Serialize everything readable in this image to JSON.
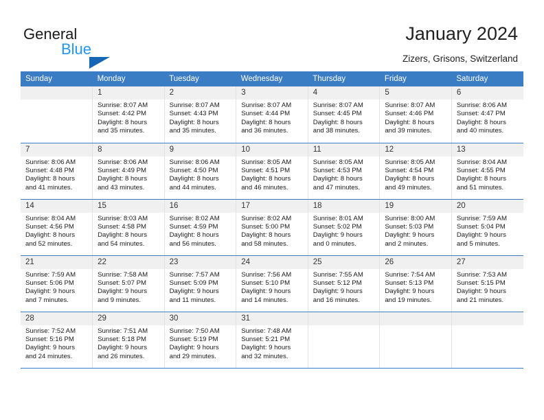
{
  "brand": {
    "line1": "General",
    "line2": "Blue",
    "triangle_color": "#1567b5",
    "blue_color": "#2196f3"
  },
  "header": {
    "title": "January 2024",
    "location": "Zizers, Grisons, Switzerland"
  },
  "theme": {
    "header_bg": "#3b7dc4",
    "daynum_bg": "#f0f0f0",
    "grid_line": "#c8c8c8"
  },
  "weekdays": [
    "Sunday",
    "Monday",
    "Tuesday",
    "Wednesday",
    "Thursday",
    "Friday",
    "Saturday"
  ],
  "weeks": [
    [
      {
        "day": "",
        "empty": true
      },
      {
        "day": "1",
        "sunrise": "Sunrise: 8:07 AM",
        "sunset": "Sunset: 4:42 PM",
        "daylight1": "Daylight: 8 hours",
        "daylight2": "and 35 minutes."
      },
      {
        "day": "2",
        "sunrise": "Sunrise: 8:07 AM",
        "sunset": "Sunset: 4:43 PM",
        "daylight1": "Daylight: 8 hours",
        "daylight2": "and 35 minutes."
      },
      {
        "day": "3",
        "sunrise": "Sunrise: 8:07 AM",
        "sunset": "Sunset: 4:44 PM",
        "daylight1": "Daylight: 8 hours",
        "daylight2": "and 36 minutes."
      },
      {
        "day": "4",
        "sunrise": "Sunrise: 8:07 AM",
        "sunset": "Sunset: 4:45 PM",
        "daylight1": "Daylight: 8 hours",
        "daylight2": "and 38 minutes."
      },
      {
        "day": "5",
        "sunrise": "Sunrise: 8:07 AM",
        "sunset": "Sunset: 4:46 PM",
        "daylight1": "Daylight: 8 hours",
        "daylight2": "and 39 minutes."
      },
      {
        "day": "6",
        "sunrise": "Sunrise: 8:06 AM",
        "sunset": "Sunset: 4:47 PM",
        "daylight1": "Daylight: 8 hours",
        "daylight2": "and 40 minutes."
      }
    ],
    [
      {
        "day": "7",
        "sunrise": "Sunrise: 8:06 AM",
        "sunset": "Sunset: 4:48 PM",
        "daylight1": "Daylight: 8 hours",
        "daylight2": "and 41 minutes."
      },
      {
        "day": "8",
        "sunrise": "Sunrise: 8:06 AM",
        "sunset": "Sunset: 4:49 PM",
        "daylight1": "Daylight: 8 hours",
        "daylight2": "and 43 minutes."
      },
      {
        "day": "9",
        "sunrise": "Sunrise: 8:06 AM",
        "sunset": "Sunset: 4:50 PM",
        "daylight1": "Daylight: 8 hours",
        "daylight2": "and 44 minutes."
      },
      {
        "day": "10",
        "sunrise": "Sunrise: 8:05 AM",
        "sunset": "Sunset: 4:51 PM",
        "daylight1": "Daylight: 8 hours",
        "daylight2": "and 46 minutes."
      },
      {
        "day": "11",
        "sunrise": "Sunrise: 8:05 AM",
        "sunset": "Sunset: 4:53 PM",
        "daylight1": "Daylight: 8 hours",
        "daylight2": "and 47 minutes."
      },
      {
        "day": "12",
        "sunrise": "Sunrise: 8:05 AM",
        "sunset": "Sunset: 4:54 PM",
        "daylight1": "Daylight: 8 hours",
        "daylight2": "and 49 minutes."
      },
      {
        "day": "13",
        "sunrise": "Sunrise: 8:04 AM",
        "sunset": "Sunset: 4:55 PM",
        "daylight1": "Daylight: 8 hours",
        "daylight2": "and 51 minutes."
      }
    ],
    [
      {
        "day": "14",
        "sunrise": "Sunrise: 8:04 AM",
        "sunset": "Sunset: 4:56 PM",
        "daylight1": "Daylight: 8 hours",
        "daylight2": "and 52 minutes."
      },
      {
        "day": "15",
        "sunrise": "Sunrise: 8:03 AM",
        "sunset": "Sunset: 4:58 PM",
        "daylight1": "Daylight: 8 hours",
        "daylight2": "and 54 minutes."
      },
      {
        "day": "16",
        "sunrise": "Sunrise: 8:02 AM",
        "sunset": "Sunset: 4:59 PM",
        "daylight1": "Daylight: 8 hours",
        "daylight2": "and 56 minutes."
      },
      {
        "day": "17",
        "sunrise": "Sunrise: 8:02 AM",
        "sunset": "Sunset: 5:00 PM",
        "daylight1": "Daylight: 8 hours",
        "daylight2": "and 58 minutes."
      },
      {
        "day": "18",
        "sunrise": "Sunrise: 8:01 AM",
        "sunset": "Sunset: 5:02 PM",
        "daylight1": "Daylight: 9 hours",
        "daylight2": "and 0 minutes."
      },
      {
        "day": "19",
        "sunrise": "Sunrise: 8:00 AM",
        "sunset": "Sunset: 5:03 PM",
        "daylight1": "Daylight: 9 hours",
        "daylight2": "and 2 minutes."
      },
      {
        "day": "20",
        "sunrise": "Sunrise: 7:59 AM",
        "sunset": "Sunset: 5:04 PM",
        "daylight1": "Daylight: 9 hours",
        "daylight2": "and 5 minutes."
      }
    ],
    [
      {
        "day": "21",
        "sunrise": "Sunrise: 7:59 AM",
        "sunset": "Sunset: 5:06 PM",
        "daylight1": "Daylight: 9 hours",
        "daylight2": "and 7 minutes."
      },
      {
        "day": "22",
        "sunrise": "Sunrise: 7:58 AM",
        "sunset": "Sunset: 5:07 PM",
        "daylight1": "Daylight: 9 hours",
        "daylight2": "and 9 minutes."
      },
      {
        "day": "23",
        "sunrise": "Sunrise: 7:57 AM",
        "sunset": "Sunset: 5:09 PM",
        "daylight1": "Daylight: 9 hours",
        "daylight2": "and 11 minutes."
      },
      {
        "day": "24",
        "sunrise": "Sunrise: 7:56 AM",
        "sunset": "Sunset: 5:10 PM",
        "daylight1": "Daylight: 9 hours",
        "daylight2": "and 14 minutes."
      },
      {
        "day": "25",
        "sunrise": "Sunrise: 7:55 AM",
        "sunset": "Sunset: 5:12 PM",
        "daylight1": "Daylight: 9 hours",
        "daylight2": "and 16 minutes."
      },
      {
        "day": "26",
        "sunrise": "Sunrise: 7:54 AM",
        "sunset": "Sunset: 5:13 PM",
        "daylight1": "Daylight: 9 hours",
        "daylight2": "and 19 minutes."
      },
      {
        "day": "27",
        "sunrise": "Sunrise: 7:53 AM",
        "sunset": "Sunset: 5:15 PM",
        "daylight1": "Daylight: 9 hours",
        "daylight2": "and 21 minutes."
      }
    ],
    [
      {
        "day": "28",
        "sunrise": "Sunrise: 7:52 AM",
        "sunset": "Sunset: 5:16 PM",
        "daylight1": "Daylight: 9 hours",
        "daylight2": "and 24 minutes."
      },
      {
        "day": "29",
        "sunrise": "Sunrise: 7:51 AM",
        "sunset": "Sunset: 5:18 PM",
        "daylight1": "Daylight: 9 hours",
        "daylight2": "and 26 minutes."
      },
      {
        "day": "30",
        "sunrise": "Sunrise: 7:50 AM",
        "sunset": "Sunset: 5:19 PM",
        "daylight1": "Daylight: 9 hours",
        "daylight2": "and 29 minutes."
      },
      {
        "day": "31",
        "sunrise": "Sunrise: 7:48 AM",
        "sunset": "Sunset: 5:21 PM",
        "daylight1": "Daylight: 9 hours",
        "daylight2": "and 32 minutes."
      },
      {
        "day": "",
        "empty": true
      },
      {
        "day": "",
        "empty": true
      },
      {
        "day": "",
        "empty": true
      }
    ]
  ]
}
